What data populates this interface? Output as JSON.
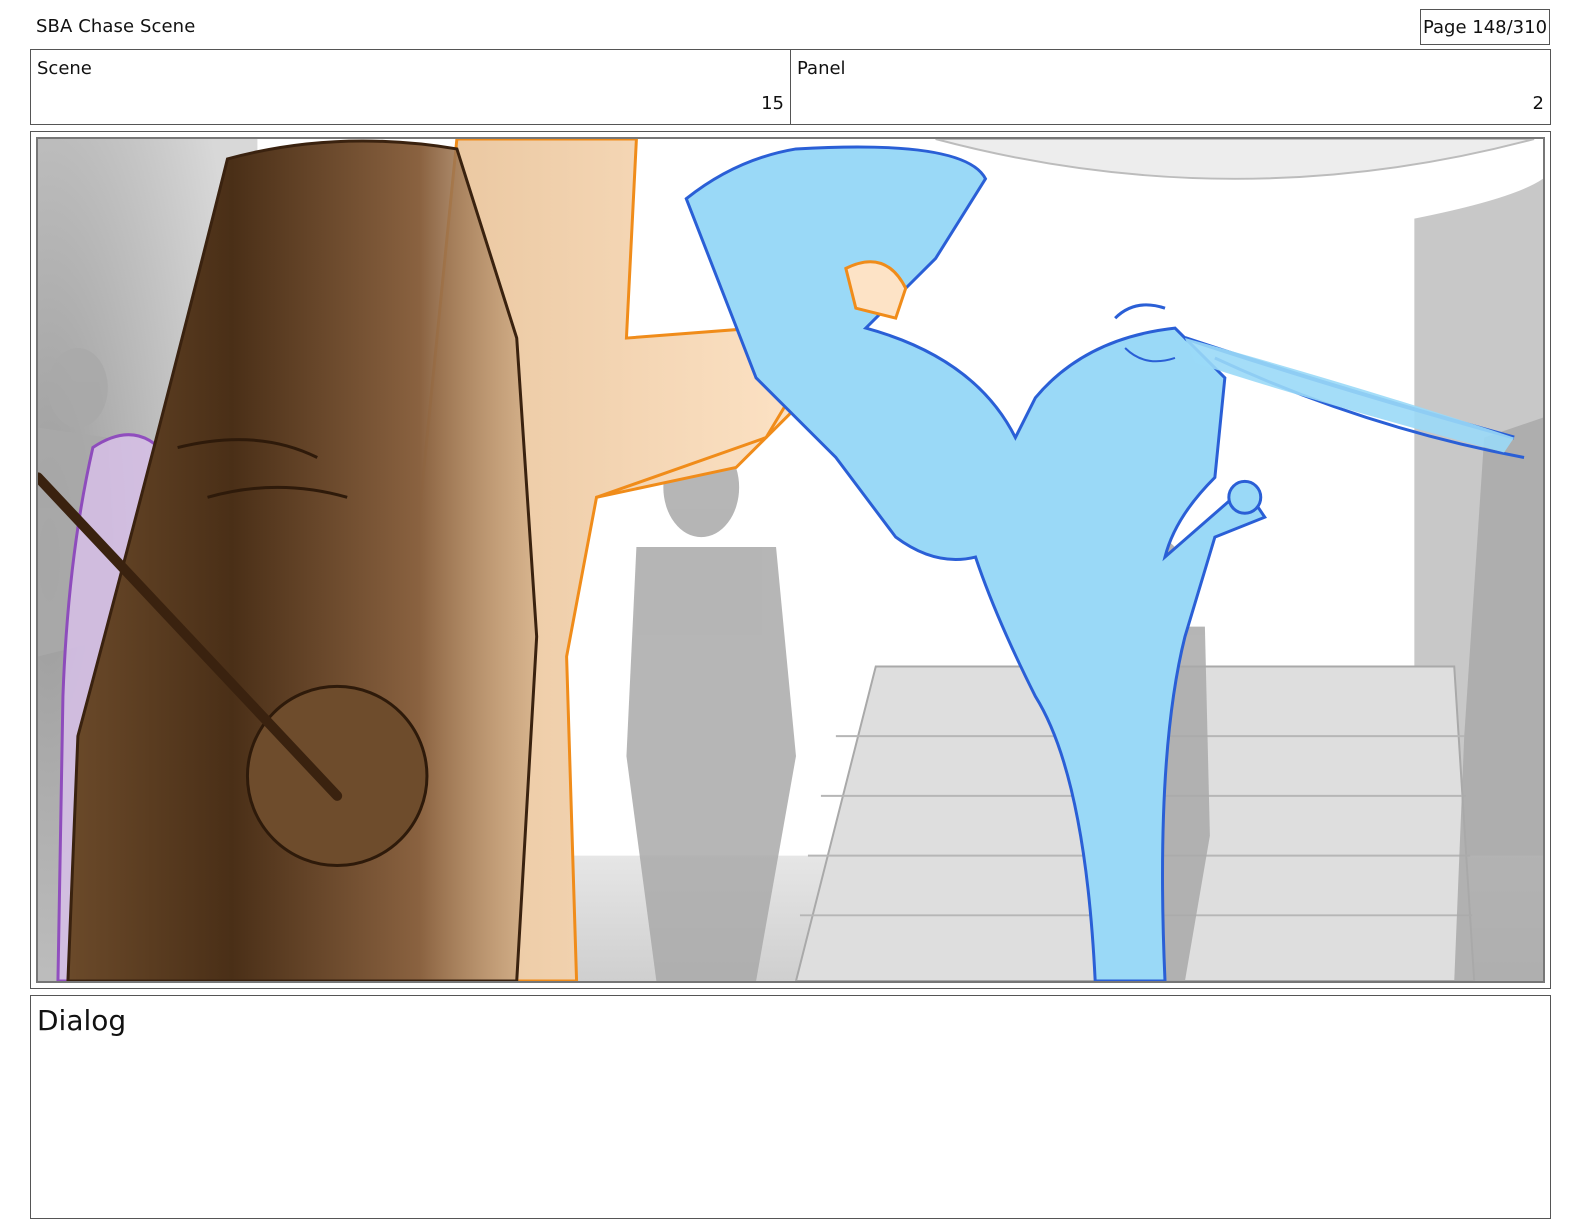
{
  "header": {
    "title": "SBA Chase Scene",
    "page": "Page 148/310"
  },
  "info": {
    "scene_label": "Scene",
    "scene_value": "15",
    "panel_label": "Panel",
    "panel_value": "2"
  },
  "dialog": {
    "label": "Dialog",
    "text": ""
  },
  "colors": {
    "foreground_brown": "#5a3a1e",
    "orange_character": "#f08c1a",
    "blue_character": "#9ad9f7",
    "blue_line": "#2a5fd6",
    "purple_character": "#8a3cc0",
    "background_gray": "#bdbdbd"
  }
}
